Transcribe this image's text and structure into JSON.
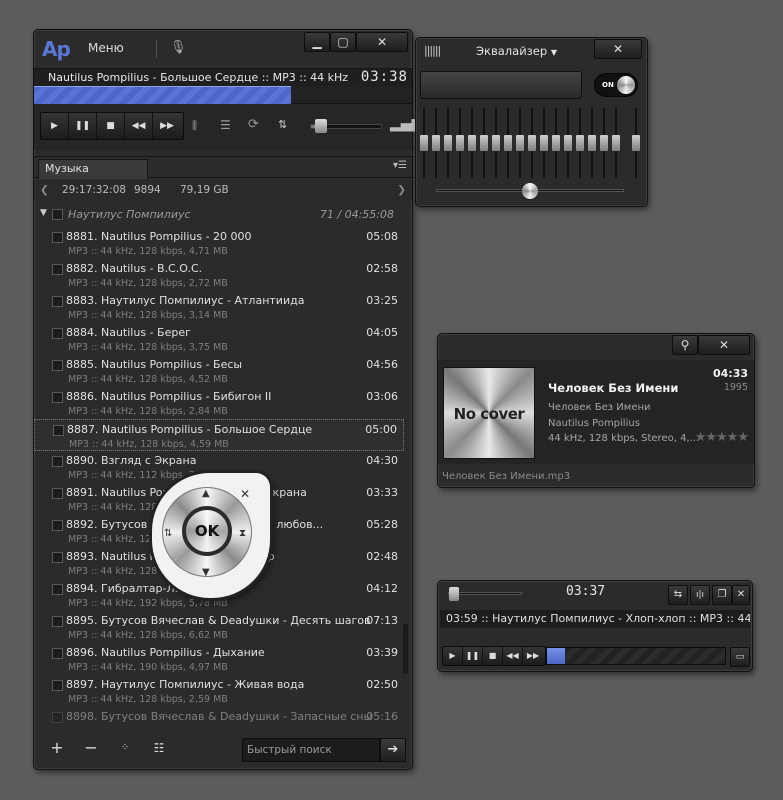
{
  "main": {
    "logo": "Ap",
    "menu_label": "Меню",
    "now_playing": "Nautilus Pompilius - Большое Сердце :: MP3 :: 44 kHz, 128",
    "time": "03:38",
    "progress": 0.68,
    "volume": 0.12,
    "tab_label": "Музыка",
    "stats": {
      "duration": "29:17:32:08",
      "count": "9894",
      "size": "79,19 GB"
    },
    "group": {
      "name": "Наутилус Помпилиус",
      "info": "71 / 04:55:08"
    },
    "tracks": [
      {
        "title": "8881. Nautilus Pompilius - 20 000",
        "meta": "MP3 :: 44 kHz, 128 kbps, 4,71 MB",
        "dur": "05:08"
      },
      {
        "title": "8882. Nautilus - B.C.O.C.",
        "meta": "MP3 :: 44 kHz, 128 kbps, 2,72 MB",
        "dur": "02:58"
      },
      {
        "title": "8883. Наутилус Помпилиус - Атлантиида",
        "meta": "MP3 :: 44 kHz, 128 kbps, 3,14 MB",
        "dur": "03:25"
      },
      {
        "title": "8884. Nautilus - Берег",
        "meta": "MP3 :: 44 kHz, 128 kbps, 3,75 MB",
        "dur": "04:05"
      },
      {
        "title": "8885. Nautilus Pompilius - Бесы",
        "meta": "MP3 :: 44 kHz, 128 kbps, 4,52 MB",
        "dur": "04:56"
      },
      {
        "title": "8886. Nautilus Pompilius - Бибигон II",
        "meta": "MP3 :: 44 kHz, 128 kbps, 2,84 MB",
        "dur": "03:06"
      },
      {
        "title": "8887. Nautilus Pompilius - Большое Сердце",
        "meta": "MP3 :: 44 kHz, 128 kbps, 4,59 MB",
        "dur": "05:00"
      },
      {
        "title": "8890. Взгляд с Экрана",
        "meta": "MP3 :: 44 kHz, 112 kbps, 3,61 MB",
        "dur": "04:30"
      },
      {
        "title": "8891. Nautilus Pompilius - Взгляд с экрана",
        "meta": "MP3 :: 44 kHz, 128 kbps, 3,27 MB",
        "dur": "03:33"
      },
      {
        "title": "8892. Бутусов Вячеслав - Вот тогда любов...",
        "meta": "MP3 :: 44 kHz, 128 kbps, 5,02 MB",
        "dur": "05:28"
      },
      {
        "title": "8893. Nautilus Pompilius - Гибралтар",
        "meta": "MP3 :: 44 kHz, 128 kbps, 2,61 MB",
        "dur": "02:48"
      },
      {
        "title": "8894. Гибралтар-Лабрадор",
        "meta": "MP3 :: 44 kHz, 192 kbps, 5,78 MB",
        "dur": "04:12"
      },
      {
        "title": "8895. Бутусов Вячеслав & Deadушки - Десять шагов",
        "meta": "MP3 :: 44 kHz, 128 kbps, 6,62 MB",
        "dur": "07:13"
      },
      {
        "title": "8896. Nautilus Pompilius - Дыхание",
        "meta": "MP3 :: 44 kHz, 190 kbps, 4,97 MB",
        "dur": "03:39"
      },
      {
        "title": "8897. Наутилус Помпилиус - Живая вода",
        "meta": "MP3 :: 44 kHz, 128 kbps, 2,59 MB",
        "dur": "02:50"
      },
      {
        "title": "8898. Бутусов Вячеслав & Deadушки - Запасные сны",
        "meta": "",
        "dur": "05:16"
      }
    ],
    "selected_index": 6,
    "search_placeholder": "Быстрый поиск"
  },
  "remote": {
    "ok_label": "OK"
  },
  "equalizer": {
    "title": "Эквалайзер",
    "on_label": "ON",
    "bands": [
      0.5,
      0.5,
      0.5,
      0.5,
      0.5,
      0.5,
      0.5,
      0.5,
      0.5,
      0.5,
      0.5,
      0.5,
      0.5,
      0.5,
      0.5,
      0.5,
      0.5,
      0.5
    ],
    "preamp": 0.5,
    "balance": 0.5
  },
  "info": {
    "cover_text": "No cover",
    "title": "Человек Без Имени",
    "time": "04:33",
    "year": "1995",
    "album": "Человек Без Имени",
    "artist": "Nautilus Pompilius",
    "tech": "44 kHz, 128 kbps, Stereo, 4,...",
    "rating_stars": "★★★★★",
    "filename": "Человек Без Имени.mp3"
  },
  "mini": {
    "time": "03:37",
    "ticker": "03:59 :: Наутилус Помпилиус - Хлоп-хлоп :: MP3 :: 44 kHz,",
    "progress": 0.1
  }
}
